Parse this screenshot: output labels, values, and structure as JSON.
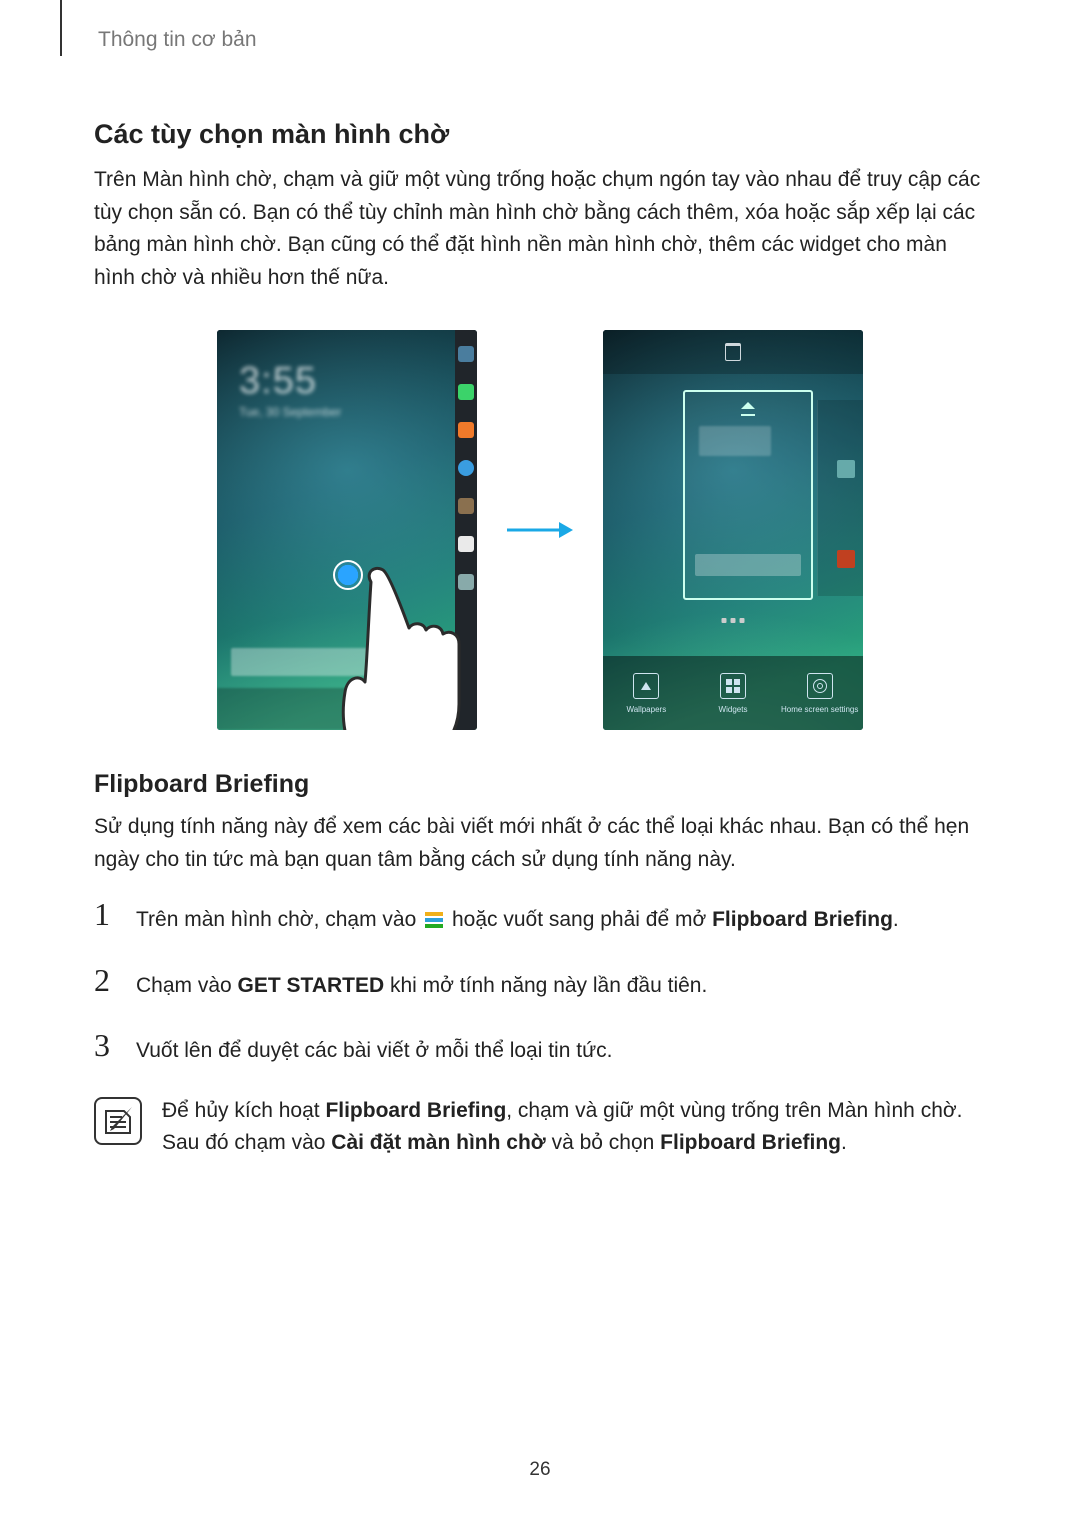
{
  "header": {
    "section": "Thông tin cơ bản"
  },
  "s1": {
    "title": "Các tùy chọn màn hình chờ",
    "para": "Trên Màn hình chờ, chạm và giữ một vùng trống hoặc chụm ngón tay vào nhau để truy cập các tùy chọn sẵn có. Bạn có thể tùy chỉnh màn hình chờ bằng cách thêm, xóa hoặc sắp xếp lại các bảng màn hình chờ. Bạn cũng có thể đặt hình nền màn hình chờ, thêm các widget cho màn hình chờ và nhiều hơn thế nữa."
  },
  "fig": {
    "toolbar": {
      "wallpapers": "Wallpapers",
      "widgets": "Widgets",
      "settings": "Home screen settings"
    }
  },
  "s2": {
    "title": "Flipboard Briefing",
    "para": "Sử dụng tính năng này để xem các bài viết mới nhất ở các thể loại khác nhau. Bạn có thể hẹn ngày cho tin tức mà bạn quan tâm bằng cách sử dụng tính năng này."
  },
  "steps": {
    "s1_a": "Trên màn hình chờ, chạm vào ",
    "s1_b": " hoặc vuốt sang phải để mở ",
    "s1_bold": "Flipboard Briefing",
    "s1_end": ".",
    "s2_a": "Chạm vào ",
    "s2_bold": "GET STARTED",
    "s2_b": " khi mở tính năng này lần đầu tiên.",
    "s3": "Vuốt lên để duyệt các bài viết ở mỗi thể loại tin tức."
  },
  "note": {
    "a": "Để hủy kích hoạt ",
    "b1": "Flipboard Briefing",
    "c": ", chạm và giữ một vùng trống trên Màn hình chờ. Sau đó chạm vào ",
    "b2": "Cài đặt màn hình chờ",
    "d": " và bỏ chọn ",
    "b3": "Flipboard Briefing",
    "e": "."
  },
  "pagenum": "26"
}
